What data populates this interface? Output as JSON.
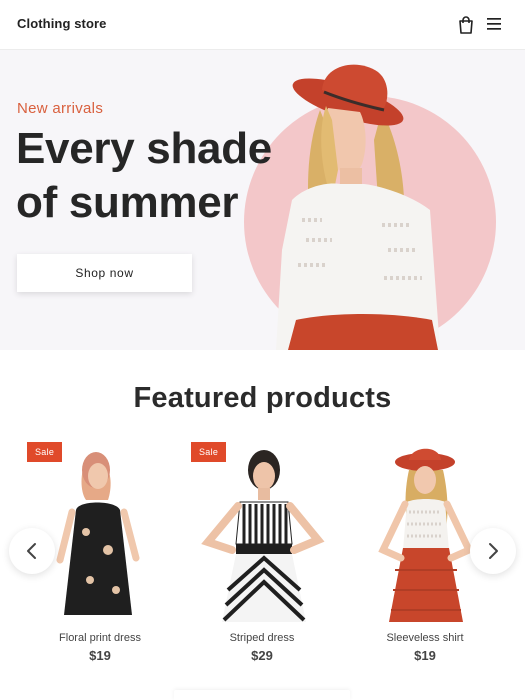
{
  "header": {
    "brand": "Clothing store",
    "icons": {
      "bag": "shopping-bag-icon",
      "menu": "hamburger-menu-icon"
    }
  },
  "hero": {
    "kicker": "New arrivals",
    "title": "Every shade of summer",
    "cta_label": "Shop now",
    "colors": {
      "accent": "#d9603e",
      "circle": "#f3c7c9",
      "background": "#f7f6f9"
    }
  },
  "featured": {
    "title": "Featured products",
    "products": [
      {
        "name": "Floral print dress",
        "price": "$19",
        "badge": "Sale"
      },
      {
        "name": "Striped dress",
        "price": "$29",
        "badge": "Sale"
      },
      {
        "name": "Sleeveless shirt",
        "price": "$19",
        "badge": ""
      }
    ],
    "controls": {
      "prev": "chevron-left-icon",
      "next": "chevron-right-icon"
    },
    "colors": {
      "badge": "#e04a2a"
    }
  }
}
